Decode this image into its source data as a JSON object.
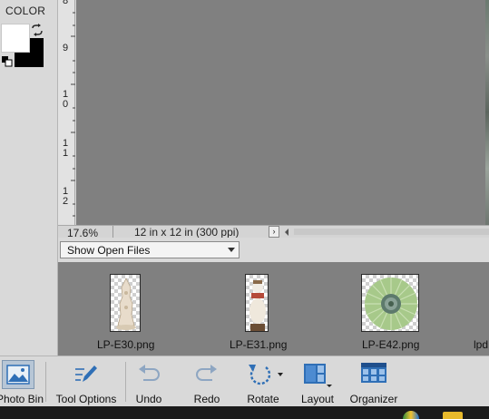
{
  "color_panel": {
    "label": "COLOR",
    "foreground": "#ffffff",
    "background": "#000000"
  },
  "ruler": {
    "marks": [
      {
        "digits": [
          "8"
        ]
      },
      {
        "digits": [
          "9"
        ]
      },
      {
        "digits": [
          "1",
          "0"
        ]
      },
      {
        "digits": [
          "1",
          "1"
        ]
      },
      {
        "digits": [
          "1",
          "2"
        ]
      }
    ]
  },
  "status_bar": {
    "zoom": "17.6%",
    "doc_size": "12 in x 12 in (300 ppi)",
    "arrow": "›"
  },
  "bin_header": {
    "dropdown_value": "Show Open Files"
  },
  "photo_bin": {
    "items": [
      {
        "label": "LP-E30.png",
        "thumb": "doily-tower-thumbnail"
      },
      {
        "label": "LP-E31.png",
        "thumb": "snowman-figure-thumbnail"
      },
      {
        "label": "LP-E42.png",
        "thumb": "green-rosette-thumbnail"
      },
      {
        "label": "lpd"
      }
    ]
  },
  "taskbar": {
    "photo_bin_label": "Photo Bin",
    "tool_options_label": "Tool Options",
    "undo_label": "Undo",
    "redo_label": "Redo",
    "rotate_label": "Rotate",
    "layout_label": "Layout",
    "organizer_label": "Organizer"
  },
  "colors": {
    "canvas_bg": "#808080",
    "panel_bg": "#d9d9d9",
    "accent_blue": "#2f6fb6"
  }
}
